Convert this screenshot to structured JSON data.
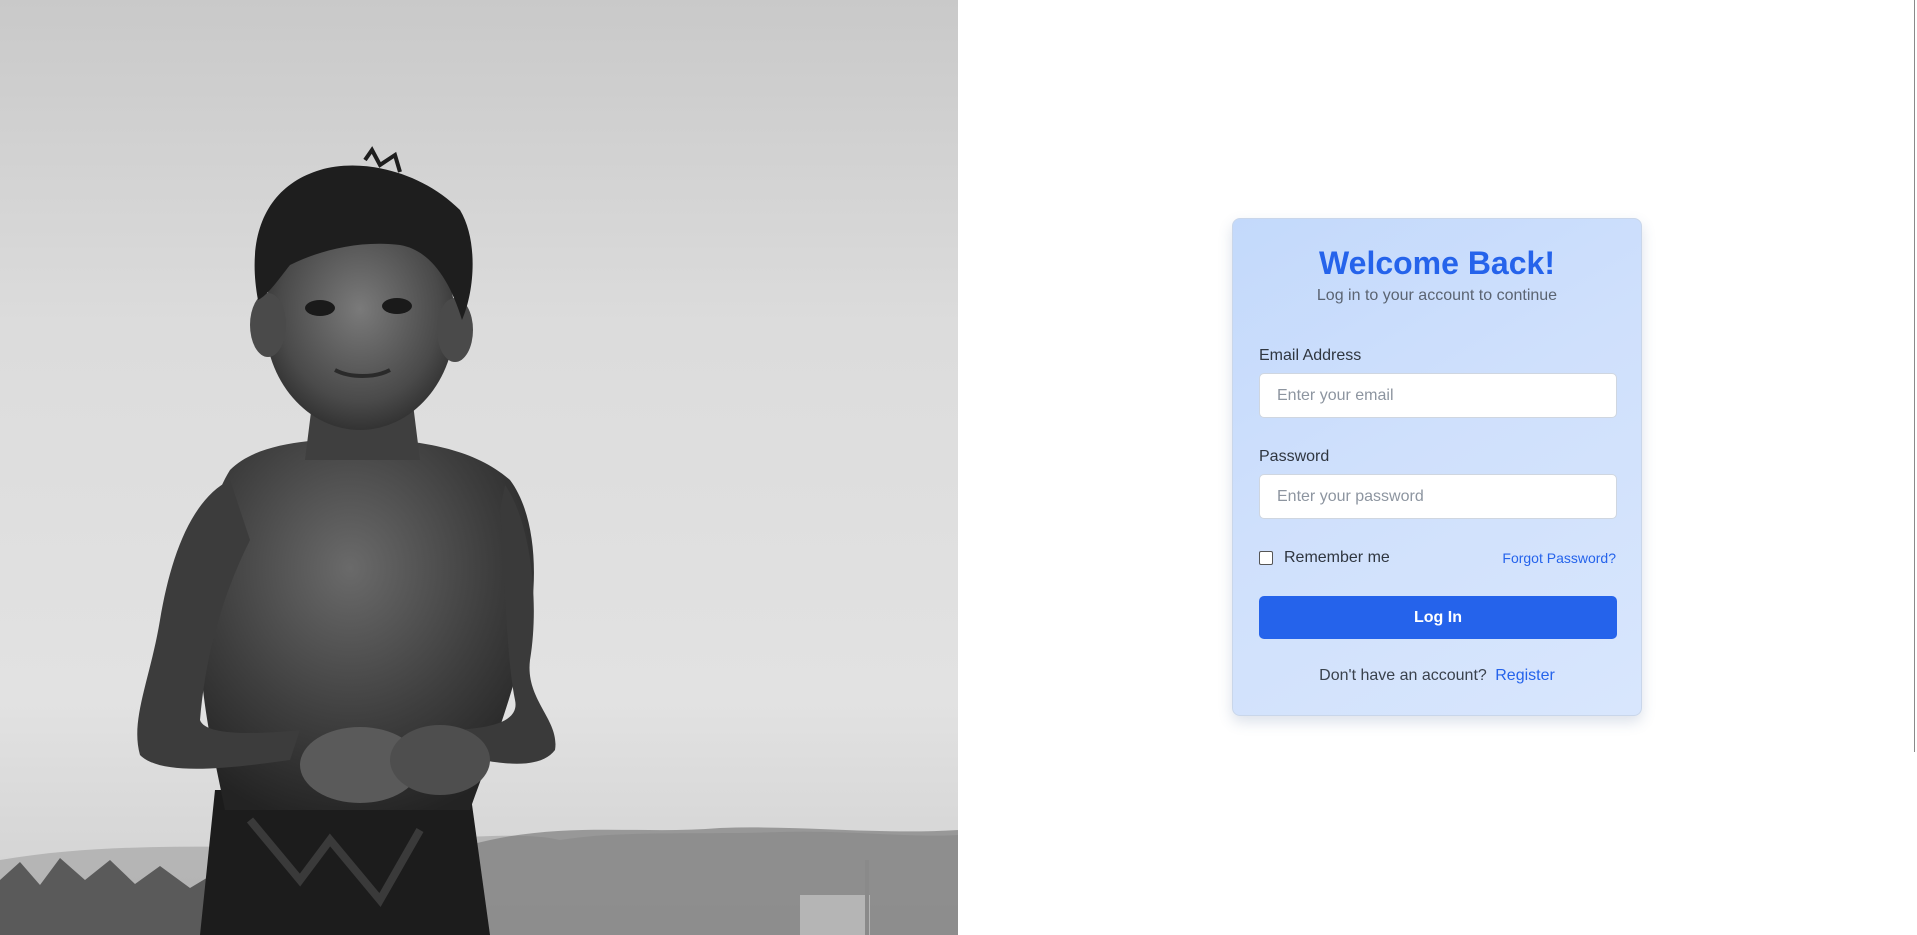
{
  "hero_image": {
    "icon": "child-portrait-photo"
  },
  "login_card": {
    "title": "Welcome Back!",
    "subtitle": "Log in to your account to continue",
    "email": {
      "label": "Email Address",
      "placeholder": "Enter your email",
      "value": ""
    },
    "password": {
      "label": "Password",
      "placeholder": "Enter your password",
      "value": ""
    },
    "remember_me": {
      "label": "Remember me",
      "checked": false
    },
    "forgot_password_label": "Forgot Password?",
    "login_button_label": "Log In",
    "register_prompt": "Don't have an account?",
    "register_link_label": "Register"
  },
  "colors": {
    "accent": "#2563eb",
    "card_background": "#cfe0fc",
    "page_background": "#ffffff"
  }
}
